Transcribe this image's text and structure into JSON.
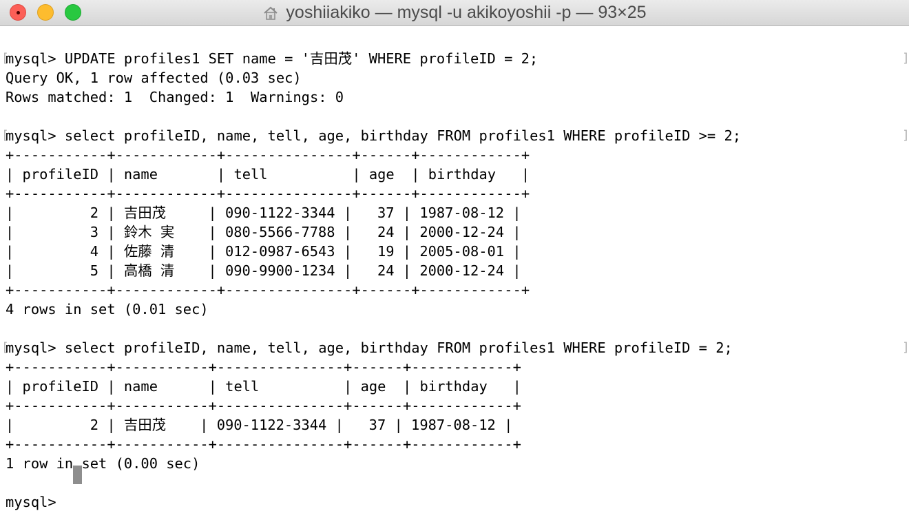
{
  "window": {
    "title": "yoshiiakiko — mysql -u akikoyoshii -p — 93×25",
    "title_icon": "home-folder-icon",
    "controls": [
      "close-button",
      "minimize-button",
      "zoom-button"
    ],
    "colors": {
      "close": "#fc5f57",
      "minimize": "#fdbc2e",
      "zoom": "#28c840",
      "text": "#000000",
      "cursor": "#8e8e8e"
    }
  },
  "terminal": {
    "lines": [
      "mysql> UPDATE profiles1 SET name = '吉田茂' WHERE profileID = 2;",
      "Query OK, 1 row affected (0.03 sec)",
      "Rows matched: 1  Changed: 1  Warnings: 0",
      "",
      "mysql> select profileID, name, tell, age, birthday FROM profiles1 WHERE profileID >= 2;",
      "+-----------+------------+---------------+------+------------+",
      "| profileID | name       | tell          | age  | birthday   |",
      "+-----------+------------+---------------+------+------------+",
      "|         2 | 吉田茂     | 090-1122-3344 |   37 | 1987-08-12 |",
      "|         3 | 鈴木 実    | 080-5566-7788 |   24 | 2000-12-24 |",
      "|         4 | 佐藤 清    | 012-0987-6543 |   19 | 2005-08-01 |",
      "|         5 | 高橋 清    | 090-9900-1234 |   24 | 2000-12-24 |",
      "+-----------+------------+---------------+------+------------+",
      "4 rows in set (0.01 sec)",
      "",
      "mysql> select profileID, name, tell, age, birthday FROM profiles1 WHERE profileID = 2;",
      "+-----------+-----------+---------------+------+------------+",
      "| profileID | name      | tell          | age  | birthday   |",
      "+-----------+-----------+---------------+------+------------+",
      "|         2 | 吉田茂    | 090-1122-3344 |   37 | 1987-08-12 |",
      "+-----------+-----------+---------------+------+------------+",
      "1 row in set (0.00 sec)",
      "",
      "mysql> "
    ],
    "marked_lines": [
      0,
      4,
      15
    ],
    "mark_left": "[",
    "mark_right": "]"
  }
}
